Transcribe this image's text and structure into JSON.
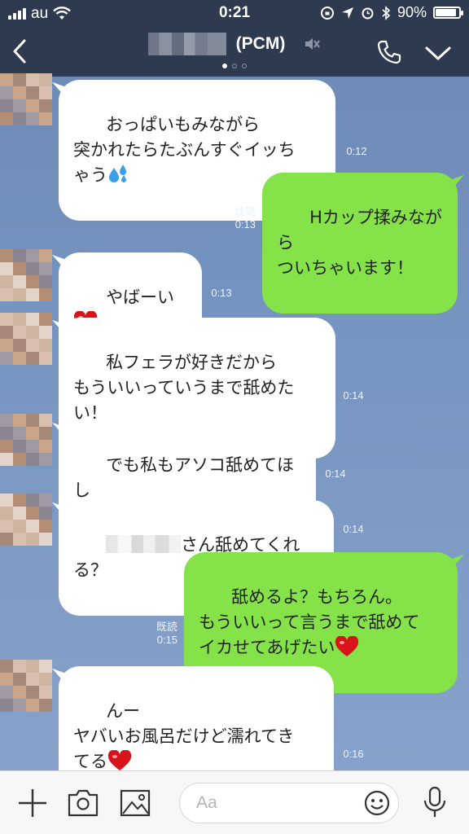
{
  "status_bar": {
    "carrier": "au",
    "time": "0:21",
    "battery": "90%",
    "battery_level": 0.9
  },
  "header": {
    "title_suffix": "(PCM)",
    "page_dots": 3,
    "active_dot": 0
  },
  "messages": [
    {
      "side": "in",
      "lines": "おっぱいもみながら\n突かれたらたぶんすぐイッち\nゃう",
      "emoji": "sweat-drops",
      "time": "0:12"
    },
    {
      "side": "out",
      "lines": "Hカップ揉みながら\nついちゃいます！",
      "read": "既読",
      "time": "0:13"
    },
    {
      "side": "in",
      "lines": "やばーい",
      "emoji": "heart",
      "time": "0:13"
    },
    {
      "side": "in",
      "lines": "私フェラが好きだから\nもういいっていうまで舐めた\nい！",
      "time": "0:14"
    },
    {
      "side": "in",
      "lines": "でも私もアソコ舐めてほし\nい。。。",
      "time": "0:14"
    },
    {
      "side": "in",
      "lines": "さん舐めてくれる？",
      "prefix_blurred": true,
      "time": "0:14"
    },
    {
      "side": "out",
      "lines": "舐めるよ？もちろん。\nもういいって言うまで舐めて\nイカせてあげたい",
      "emoji": "heart",
      "read": "既読",
      "time": "0:15"
    },
    {
      "side": "in",
      "lines": "んー\nヤバいお風呂だけど濡れてき\nてる",
      "emoji": "heart",
      "time": "0:16"
    }
  ],
  "input": {
    "placeholder": "Aa"
  },
  "colors": {
    "header_bg": "#2e3a4f",
    "chat_bg": "#7593c0",
    "outgoing_bubble": "#85e249",
    "incoming_bubble": "#ffffff",
    "heart": "#d7141a"
  },
  "icons": [
    "back-icon",
    "mute-icon",
    "phone-icon",
    "chevron-down-icon",
    "plus-icon",
    "camera-icon",
    "image-icon",
    "emoji-icon",
    "mic-icon"
  ]
}
